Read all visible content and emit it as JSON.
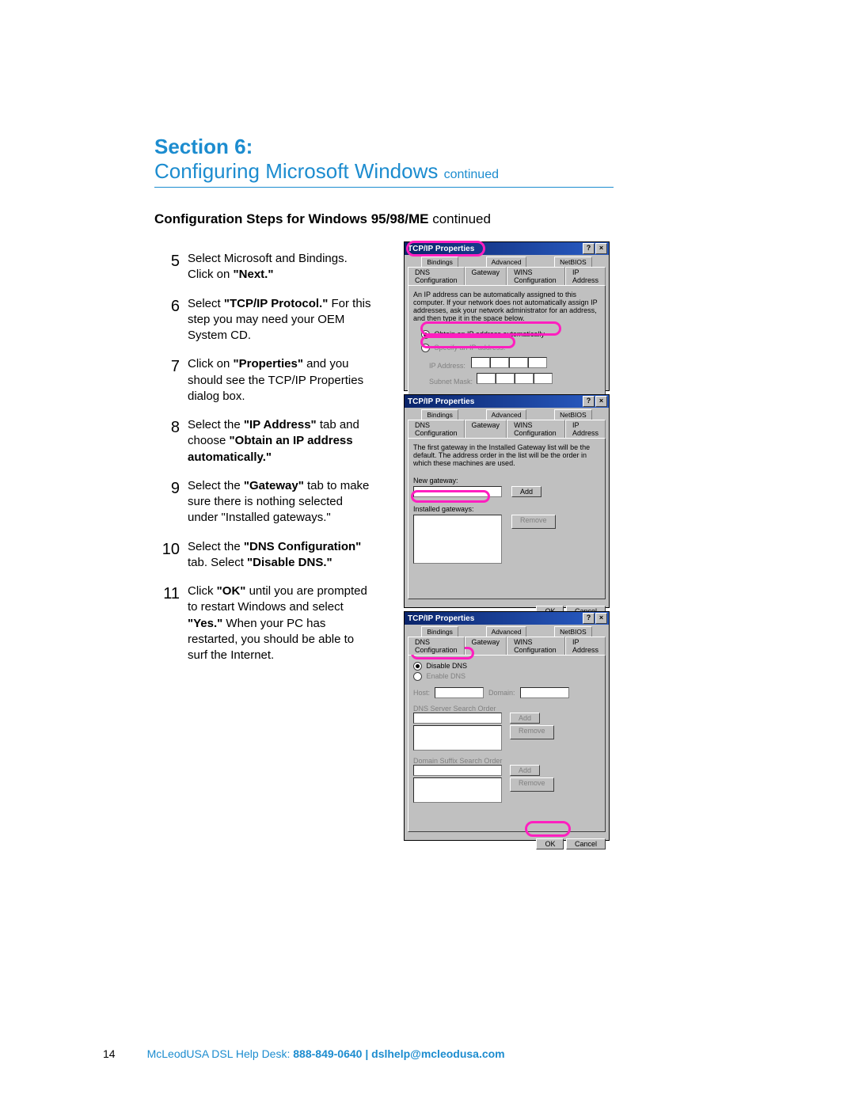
{
  "section": {
    "label": "Section 6:",
    "title_main": "Configuring Microsoft Windows",
    "title_suffix": "continued"
  },
  "subheading": {
    "main": "Configuration Steps for Windows 95/98/ME",
    "suffix": "continued"
  },
  "steps": [
    {
      "n": "5",
      "pre": "Select Microsoft and Bindings. Click on ",
      "b1": "\"Next.\"",
      "post": ""
    },
    {
      "n": "6",
      "pre": "Select ",
      "b1": "\"TCP/IP Protocol.\"",
      "post": " For this step you may need your OEM System CD."
    },
    {
      "n": "7",
      "pre": "Click on ",
      "b1": "\"Properties\"",
      "post": " and you should see the TCP/IP Properties dialog box."
    },
    {
      "n": "8",
      "pre": "Select the ",
      "b1": "\"IP Address\"",
      "mid": " tab and choose ",
      "b2": "\"Obtain an IP address automatically.\"",
      "post": ""
    },
    {
      "n": "9",
      "pre": "Select the ",
      "b1": "\"Gateway\"",
      "post": " tab to make sure there is nothing selected under \"Installed gateways.\""
    },
    {
      "n": "10",
      "pre": "Select the ",
      "b1": "\"DNS Configuration\"",
      "mid": " tab. Select ",
      "b2": "\"Disable DNS.\"",
      "post": ""
    },
    {
      "n": "11",
      "pre": "Click ",
      "b1": "\"OK\"",
      "post": " until you are prompted to restart Windows and select ",
      "b2": "\"Yes.\"",
      "post2": " When your PC has restarted, you should be able to surf the Internet."
    }
  ],
  "dialog": {
    "title": "TCP/IP Properties",
    "tabs_back": [
      "Bindings",
      "Advanced",
      "NetBIOS"
    ],
    "tabs_front": [
      "DNS Configuration",
      "Gateway",
      "WINS Configuration",
      "IP Address"
    ],
    "buttons": {
      "ok": "OK",
      "cancel": "Cancel",
      "add": "Add",
      "remove": "Remove",
      "help": "?",
      "close": "×"
    }
  },
  "dlg1": {
    "msg": "An IP address can be automatically assigned to this computer. If your network does not automatically assign IP addresses, ask your network administrator for an address, and then type it in the space below.",
    "opt_auto": "Obtain an IP address automatically",
    "opt_spec": "Specify an IP address:",
    "lbl_ip": "IP Address:",
    "lbl_mask": "Subnet Mask:"
  },
  "dlg2": {
    "msg": "The first gateway in the Installed Gateway list will be the default. The address order in the list will be the order in which these machines are used.",
    "lbl_new": "New gateway:",
    "lbl_installed": "Installed gateways:"
  },
  "dlg3": {
    "opt_disable": "Disable DNS",
    "opt_enable": "Enable DNS",
    "lbl_host": "Host:",
    "lbl_domain": "Domain:",
    "lbl_search": "DNS Server Search Order",
    "lbl_suffix": "Domain Suffix Search Order"
  },
  "footer": {
    "page": "14",
    "org": "McLeodUSA DSL Help Desk:",
    "phone": "888-849-0640",
    "sep": " | ",
    "email": "dslhelp@mcleodusa.com"
  }
}
